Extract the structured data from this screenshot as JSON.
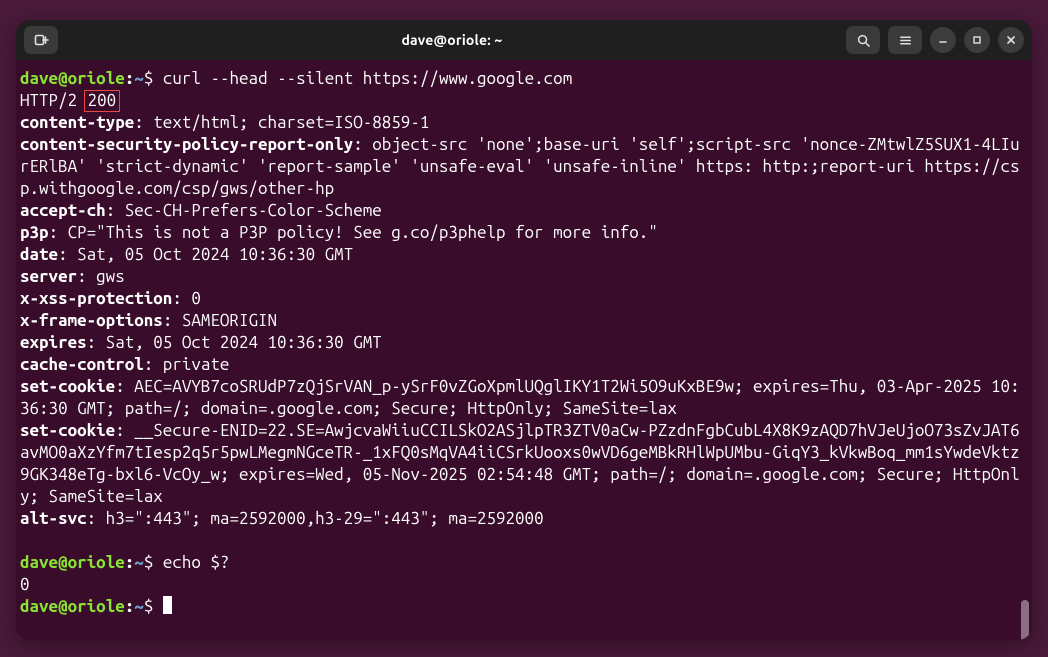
{
  "window": {
    "title": "dave@oriole: ~"
  },
  "prompt": {
    "user": "dave",
    "at": "@",
    "host": "oriole",
    "colon": ":",
    "path": "~",
    "dollar": "$"
  },
  "cmd1": " curl --head --silent https://www.google.com",
  "resp": {
    "http_pre": "HTTP/2 ",
    "http_code": "200",
    "http_post": " ",
    "content_type_k": "content-type",
    "content_type_v": ": text/html; charset=ISO-8859-1",
    "csp_k": "content-security-policy-report-only",
    "csp_v": ": object-src 'none';base-uri 'self';script-src 'nonce-ZMtwlZ5SUX1-4LIurERlBA' 'strict-dynamic' 'report-sample' 'unsafe-eval' 'unsafe-inline' https: http:;report-uri https://csp.withgoogle.com/csp/gws/other-hp",
    "accept_ch_k": "accept-ch",
    "accept_ch_v": ": Sec-CH-Prefers-Color-Scheme",
    "p3p_k": "p3p",
    "p3p_v": ": CP=\"This is not a P3P policy! See g.co/p3phelp for more info.\"",
    "date_k": "date",
    "date_v": ": Sat, 05 Oct 2024 10:36:30 GMT",
    "server_k": "server",
    "server_v": ": gws",
    "xss_k": "x-xss-protection",
    "xss_v": ": 0",
    "xfo_k": "x-frame-options",
    "xfo_v": ": SAMEORIGIN",
    "expires_k": "expires",
    "expires_v": ": Sat, 05 Oct 2024 10:36:30 GMT",
    "cache_k": "cache-control",
    "cache_v": ": private",
    "setcookie1_k": "set-cookie",
    "setcookie1_v": ": AEC=AVYB7coSRUdP7zQjSrVAN_p-ySrF0vZGoXpmlUQglIKY1T2Wi5O9uKxBE9w; expires=Thu, 03-Apr-2025 10:36:30 GMT; path=/; domain=.google.com; Secure; HttpOnly; SameSite=lax",
    "setcookie2_k": "set-cookie",
    "setcookie2_v": ": __Secure-ENID=22.SE=AwjcvaWiiuCCILSkO2ASjlpTR3ZTV0aCw-PZzdnFgbCubL4X8K9zAQD7hVJeUjoO73sZvJAT6avMO0aXzYfm7tIesp2q5r5pwLMegmNGceTR-_1xFQ0sMqVA4iiCSrkUooxs0wVD6geMBkRHlWpUMbu-GiqY3_kVkwBoq_mm1sYwdeVktz9GK348eTg-bxl6-VcOy_w; expires=Wed, 05-Nov-2025 02:54:48 GMT; path=/; domain=.google.com; Secure; HttpOnly; SameSite=lax",
    "altsvc_k": "alt-svc",
    "altsvc_v": ": h3=\":443\"; ma=2592000,h3-29=\":443\"; ma=2592000"
  },
  "cmd2": " echo $?",
  "cmd2_out": "0",
  "blank": ""
}
